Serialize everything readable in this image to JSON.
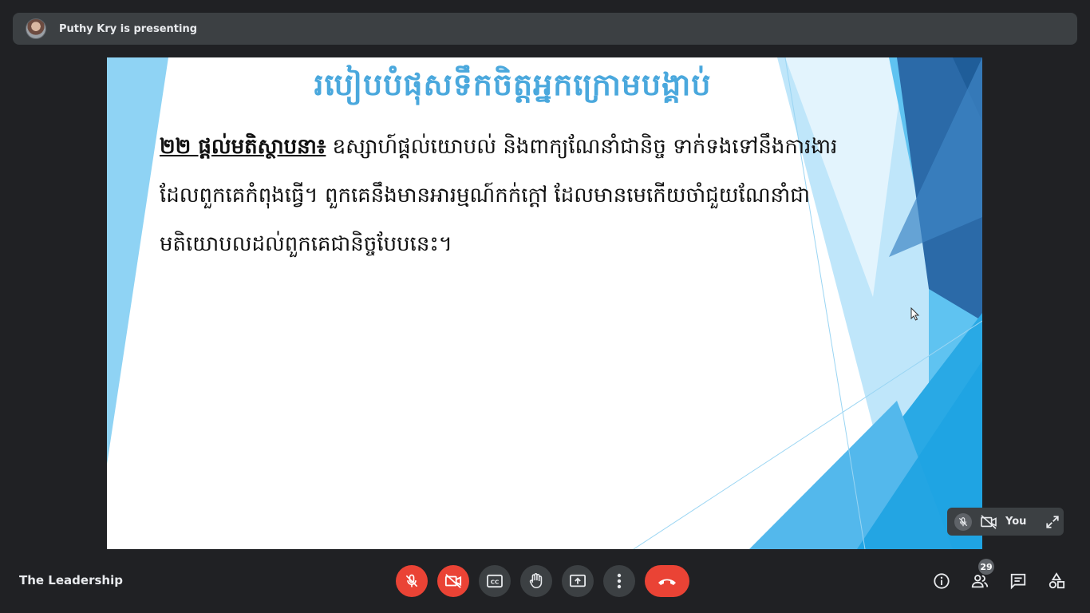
{
  "presenter": {
    "label": "Puthy Kry is presenting"
  },
  "slide": {
    "title": "របៀបបំផុសទឹកចិត្តអ្នកក្រោមបង្គាប់",
    "term": "២២ ផ្តល់មតិស្ថាបនា៖",
    "body": " ឧស្សាហ៍ផ្តល់យោបល់ និងពាក្យណែនាំជានិច្ច ទាក់ទងទៅនឹងការងារ ដែលពួកគេកំពុងធ្វើ។ ពួកគេនឹងមានអារម្មណ៍កក់ក្តៅ ដែលមានមេកើយចាំជួយណែនាំជា មតិយោបលដល់ពួកគេជានិច្ចបែបនេះ។"
  },
  "self_tile": {
    "name": "You"
  },
  "meeting": {
    "name": "The Leadership"
  },
  "participants": {
    "count": "29"
  },
  "colors": {
    "end_call": "#ea4335",
    "bar": "#202124",
    "accent_title": "#4aa8dd"
  },
  "icons": {
    "controls": [
      "mic-off-icon",
      "camera-off-icon",
      "captions-icon",
      "raise-hand-icon",
      "present-icon",
      "more-options-icon",
      "end-call-icon"
    ],
    "right": [
      "info-icon",
      "people-icon",
      "chat-icon",
      "activities-icon"
    ]
  }
}
